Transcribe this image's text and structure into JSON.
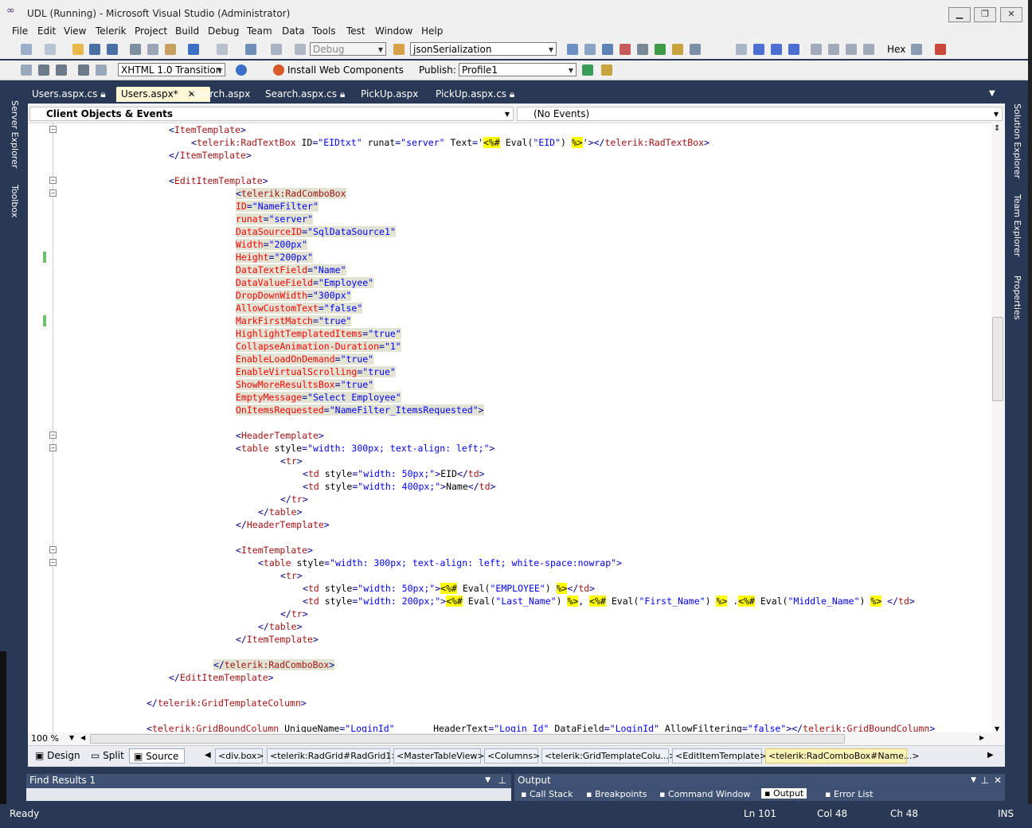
{
  "window": {
    "title": "UDL (Running) - Microsoft Visual Studio (Administrator)"
  },
  "menu": [
    "File",
    "Edit",
    "View",
    "Telerik",
    "Project",
    "Build",
    "Debug",
    "Team",
    "Data",
    "Tools",
    "Test",
    "Window",
    "Help"
  ],
  "toolbar1": {
    "config": "Debug",
    "search_combo": "jsonSerialization",
    "hex_label": "Hex"
  },
  "toolbar2": {
    "doctype": "XHTML 1.0 Transition",
    "install_label": "Install Web Components",
    "publish_label": "Publish:",
    "publish_profile": "Profile1"
  },
  "side_left": [
    "Server Explorer",
    "Toolbox"
  ],
  "side_right": [
    "Solution Explorer",
    "Team Explorer",
    "Properties"
  ],
  "tabs": [
    "Users.aspx.cs",
    "Users.aspx*",
    "Search.aspx",
    "Search.aspx.cs",
    "PickUp.aspx",
    "PickUp.aspx.cs"
  ],
  "navbar": {
    "left": "Client Objects & Events",
    "right": "(No Events)"
  },
  "code_lines": [
    "<ItemTemplate>",
    "<telerik:RadTextBox ID=\"EIDtxt\" runat=\"server\" Text='<%# Eval(\"EID\") %>'></telerik:RadTextBox>",
    "</ItemTemplate>",
    "",
    "<EditItemTemplate>",
    "<telerik:RadComboBox",
    "ID=\"NameFilter\"",
    "runat=\"server\"",
    "DataSourceID=\"SqlDataSource1\"",
    "Width=\"200px\"",
    "Height=\"200px\"",
    "DataTextField=\"Name\"",
    "DataValueField=\"Employee\"",
    "DropDownWidth=\"300px\"",
    "AllowCustomText=\"false\"",
    "MarkFirstMatch=\"true\"",
    "HighlightTemplatedItems=\"true\"",
    "CollapseAnimation-Duration=\"1\"",
    "EnableLoadOnDemand=\"true\"",
    "EnableVirtualScrolling=\"true\"",
    "ShowMoreResultsBox=\"true\"",
    "EmptyMessage=\"Select Employee\"",
    "OnItemsRequested=\"NameFilter_ItemsRequested\">",
    "",
    "<HeaderTemplate>",
    "<table style=\"width: 300px; text-align: left;\">",
    "<tr>",
    "<td style=\"width: 50px;\">EID</td>",
    "<td style=\"width: 400px;\">Name</td>",
    "</tr>",
    "</table>",
    "</HeaderTemplate>",
    "",
    "<ItemTemplate>",
    "<table style=\"width: 300px; text-align: left; white-space:nowrap\">",
    "<tr>",
    "<td style=\"width: 50px;\"><%# Eval(\"EMPLOYEE\") %></td>",
    "<td style=\"width: 200px;\"><%# Eval(\"Last_Name\") %>, <%# Eval(\"First_Name\") %> .<%# Eval(\"Middle_Name\") %> </td>",
    "</tr>",
    "</table>",
    "</ItemTemplate>",
    "",
    "</telerik:RadComboBox>",
    "</EditItemTemplate>",
    "",
    "</telerik:GridTemplateColumn>",
    "",
    "<telerik:GridBoundColumn UniqueName=\"LoginId\"       HeaderText=\"Login Id\" DataField=\"LoginId\" AllowFiltering=\"false\"></telerik:GridBoundColumn>"
  ],
  "zoom": "100 %",
  "views": {
    "design": "Design",
    "split": "Split",
    "source": "Source"
  },
  "breadcrumbs": [
    "<div.box>",
    "<telerik:RadGrid#RadGrid1>",
    "<MasterTableView>",
    "<Columns>",
    "<telerik:GridTemplateColu...>",
    "<EditItemTemplate>",
    "<telerik:RadComboBox#Name...>"
  ],
  "find_results": {
    "title": "Find Results 1"
  },
  "output": {
    "title": "Output",
    "tabs": [
      "Call Stack",
      "Breakpoints",
      "Command Window",
      "Output",
      "Error List"
    ]
  },
  "status": {
    "ready": "Ready",
    "ln": "Ln 101",
    "col": "Col 48",
    "ch": "Ch 48",
    "ins": "INS"
  }
}
